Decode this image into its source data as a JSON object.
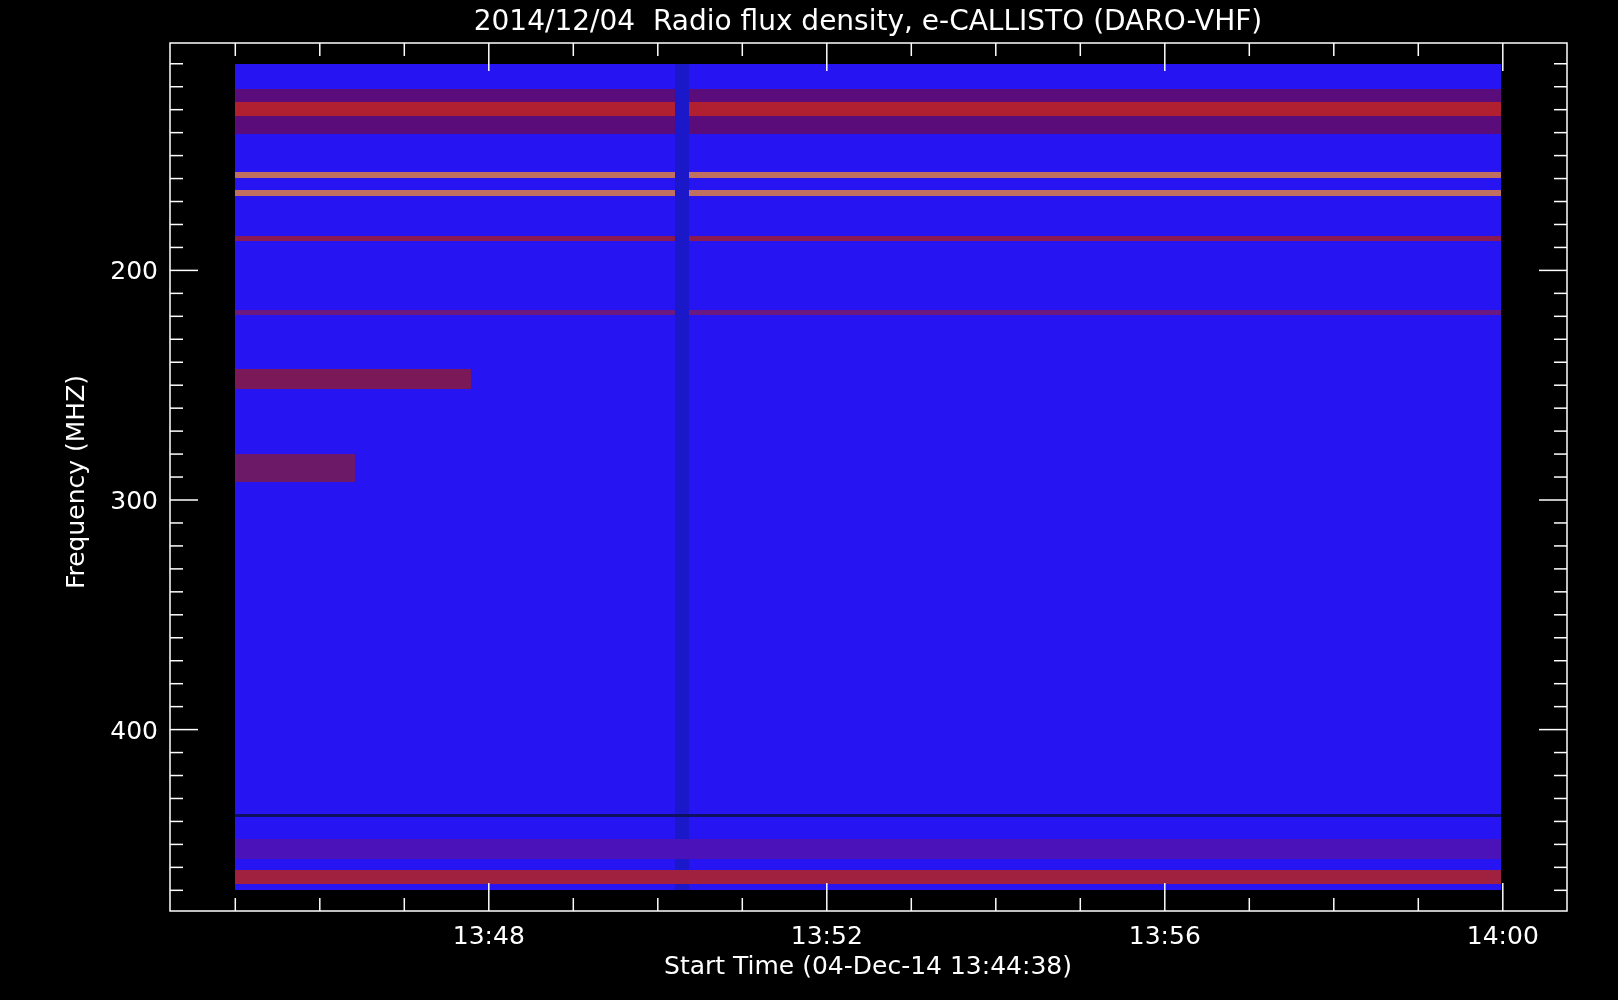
{
  "title": "2014/12/04  Radio flux density, e-CALLISTO (DARO-VHF)",
  "y_axis": {
    "label": "Frequency (MHZ)",
    "ticks": [
      "200",
      "300",
      "400"
    ]
  },
  "x_axis": {
    "label": "Start Time (04-Dec-14 13:44:38)",
    "ticks": [
      "13:48",
      "13:52",
      "13:56",
      "14:00"
    ]
  }
}
